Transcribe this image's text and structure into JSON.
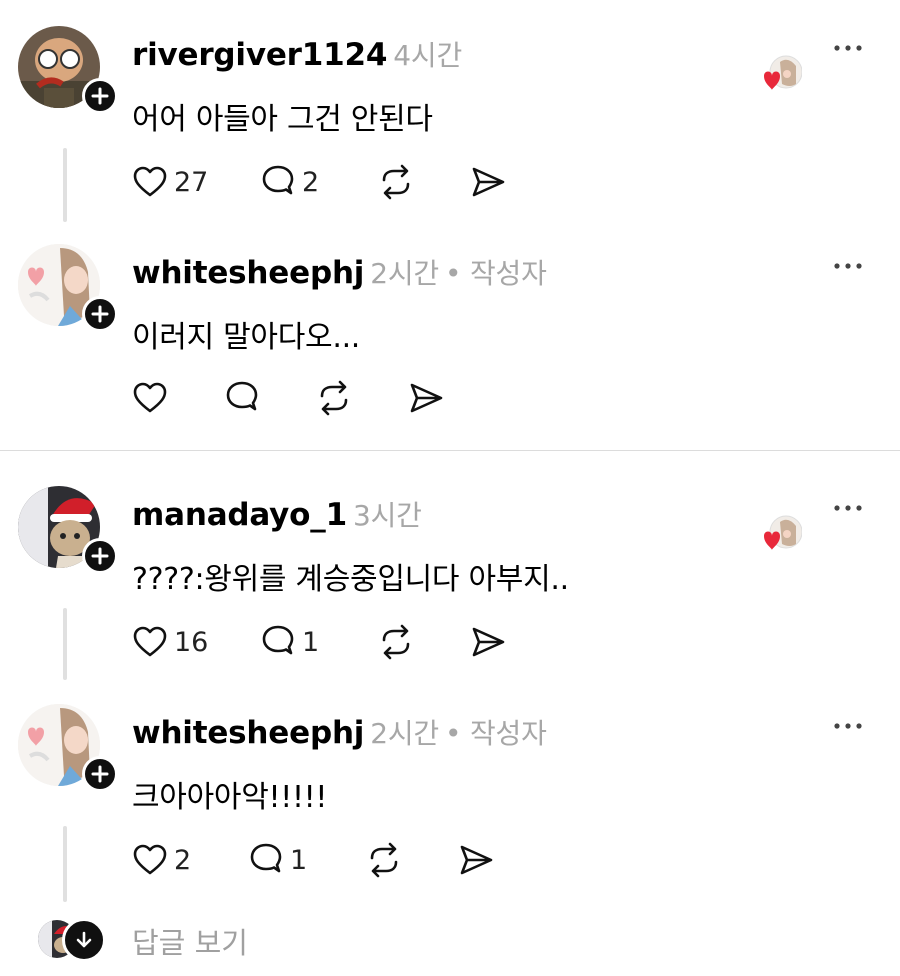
{
  "posts": [
    {
      "username": "rivergiver1124",
      "time": "4시간",
      "author_tag": "",
      "text": "어어 아들아 그건 안된다",
      "likes": "27",
      "replies": "2",
      "avatar": "old-man-avatar",
      "has_liked_by": true
    },
    {
      "username": "whitesheephj",
      "time": "2시간",
      "author_tag": "• 작성자",
      "text": "이러지 말아다오...",
      "likes": "",
      "replies": "",
      "avatar": "anime-girl-avatar",
      "has_liked_by": false
    },
    {
      "username": "manadayo_1",
      "time": "3시간",
      "author_tag": "",
      "text": "????:왕위를 계승중입니다 아부지..",
      "likes": "16",
      "replies": "1",
      "avatar": "santa-cat-avatar",
      "has_liked_by": true
    },
    {
      "username": "whitesheephj",
      "time": "2시간",
      "author_tag": "• 작성자",
      "text": "크아아아악!!!!!",
      "likes": "2",
      "replies": "1",
      "avatar": "anime-girl-avatar",
      "has_liked_by": false
    }
  ],
  "view_replies_label": "답글 보기",
  "icons": {
    "like": "heart-icon",
    "reply": "comment-bubble-icon",
    "repost": "repost-icon",
    "share": "send-icon",
    "more": "more-dots-icon",
    "follow": "plus-icon",
    "expand": "arrow-down-icon"
  },
  "colors": {
    "meta": "#a7a7a7",
    "liked_heart": "#e8283a",
    "thread_line": "#e0e0e0"
  }
}
